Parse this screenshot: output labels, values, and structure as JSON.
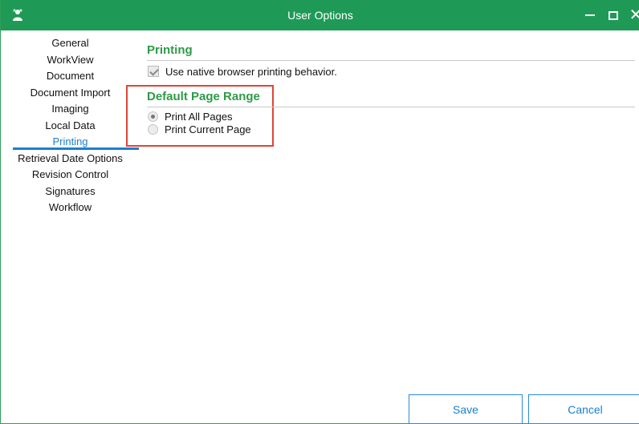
{
  "window": {
    "title": "User Options"
  },
  "sidebar": {
    "items": [
      {
        "label": "General"
      },
      {
        "label": "WorkView"
      },
      {
        "label": "Document"
      },
      {
        "label": "Document Import"
      },
      {
        "label": "Imaging"
      },
      {
        "label": "Local Data"
      },
      {
        "label": "Printing",
        "active": true
      },
      {
        "label": "Retrieval Date Options"
      },
      {
        "label": "Revision Control"
      },
      {
        "label": "Signatures"
      },
      {
        "label": "Workflow"
      }
    ]
  },
  "printing": {
    "title": "Printing",
    "native_option": {
      "label": "Use native browser printing behavior.",
      "checked": true
    }
  },
  "page_range": {
    "title": "Default Page Range",
    "options": [
      {
        "label": "Print All Pages",
        "selected": true
      },
      {
        "label": "Print Current Page",
        "selected": false
      }
    ]
  },
  "footer": {
    "save_label": "Save",
    "cancel_label": "Cancel"
  },
  "colors": {
    "titlebar": "#1f9a56",
    "section_title": "#2e9a48",
    "accent": "#1a7fd0",
    "highlight_box": "#e0453a"
  }
}
